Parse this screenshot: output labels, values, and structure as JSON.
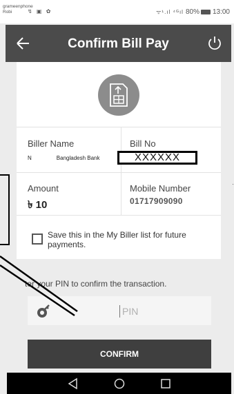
{
  "status_bar": {
    "carrier_line1": "grameenphone",
    "carrier_line2": "Robi",
    "left_icons": "↯ ▣ ✿",
    "signal_text": "ᯤ¹.ıl ⁴ᴳıl",
    "battery": "80%",
    "time": "13:00"
  },
  "app_bar": {
    "title": "Confirm Bill Pay",
    "back_icon": "back-arrow-icon",
    "power_icon": "power-icon"
  },
  "biller": {
    "name_label": "Biller Name",
    "name_mark": "N",
    "name_value": "Bangladesh Bank",
    "bill_no_label": "Bill No",
    "bill_no_value": "XXXXXX"
  },
  "amount": {
    "label": "Amount",
    "value": "৳ 10"
  },
  "mobile": {
    "label": "Mobile Number",
    "value": "01717909090"
  },
  "save_option": {
    "text": "Save this in the My Biller list for future payments.",
    "checked": false
  },
  "pin": {
    "prompt": "ter your PIN to confirm the transaction.",
    "placeholder": "PIN"
  },
  "confirm_button": {
    "label": "CONFIRM"
  },
  "edge_mark": "·",
  "colors": {
    "app_bar": "#4b4b4b",
    "button": "#3f3f3f",
    "icon_circle": "#8c8c8c"
  }
}
